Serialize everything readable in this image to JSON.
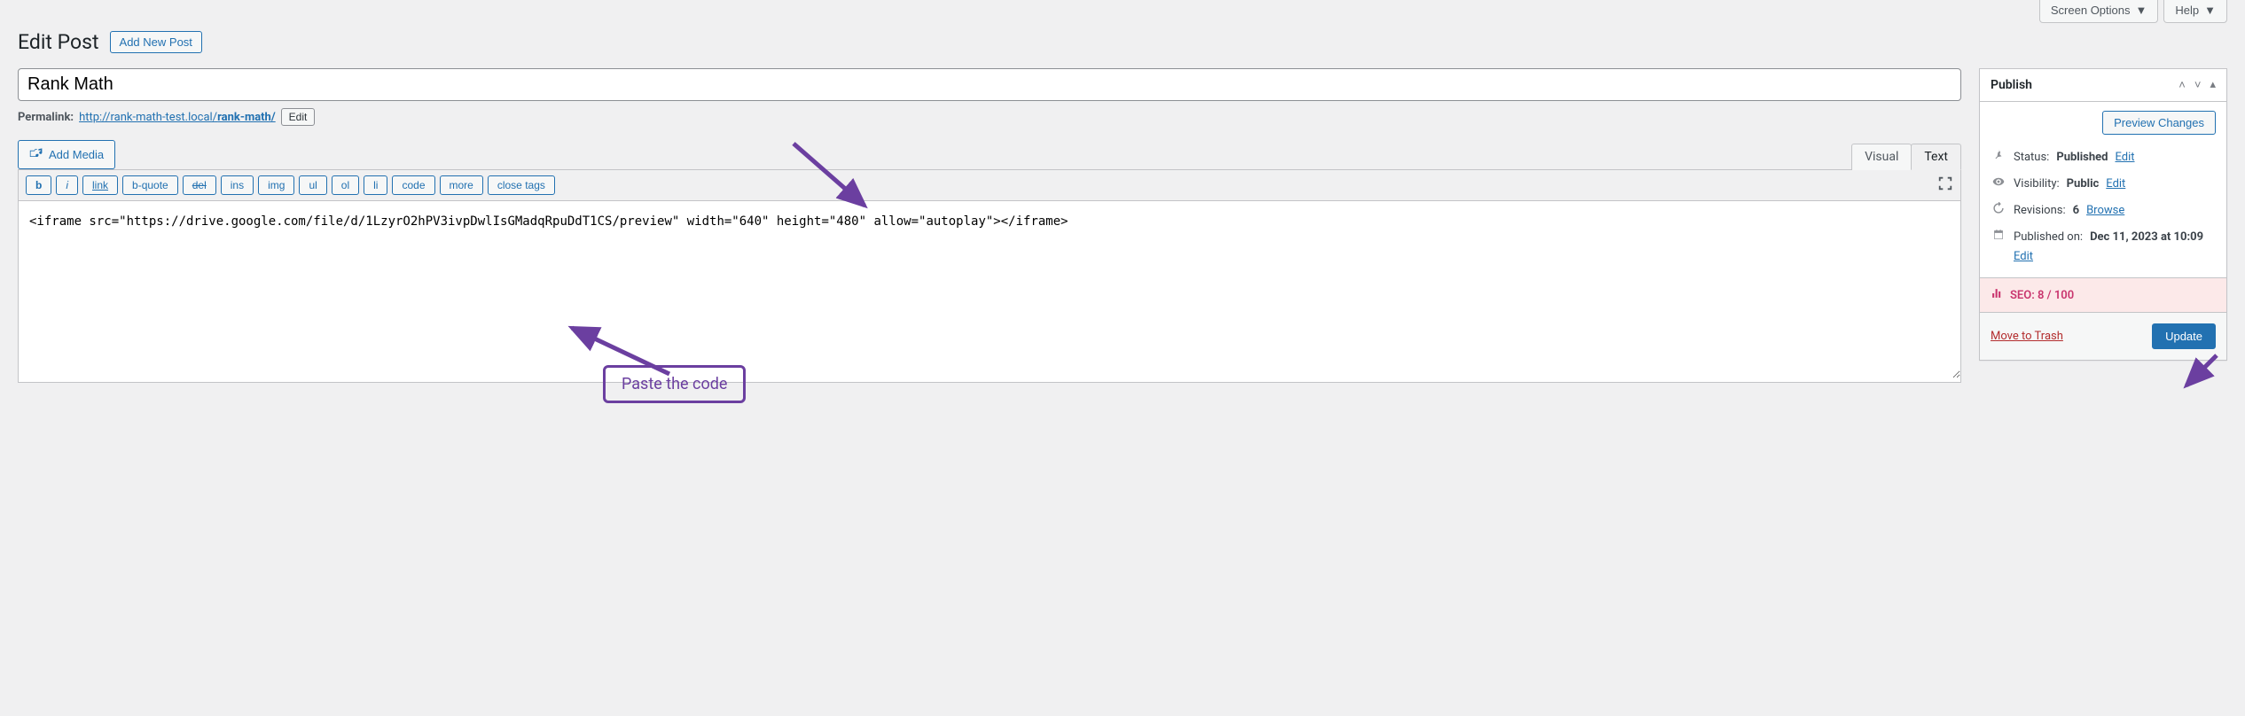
{
  "topbar": {
    "screen_options": "Screen Options",
    "help": "Help"
  },
  "header": {
    "title": "Edit Post",
    "add_new": "Add New Post"
  },
  "post": {
    "title": "Rank Math",
    "permalink_label": "Permalink:",
    "permalink_base": "http://rank-math-test.local/",
    "permalink_slug": "rank-math/",
    "edit_slug": "Edit"
  },
  "media": {
    "add_media": "Add Media"
  },
  "tabs": {
    "visual": "Visual",
    "text": "Text"
  },
  "quicktags": {
    "b": "b",
    "i": "i",
    "link": "link",
    "bquote": "b-quote",
    "del": "del",
    "ins": "ins",
    "img": "img",
    "ul": "ul",
    "ol": "ol",
    "li": "li",
    "code": "code",
    "more": "more",
    "close": "close tags"
  },
  "editor": {
    "content": "<iframe src=\"https://drive.google.com/file/d/1LzyrO2hPV3ivpDwlIsGMadqRpuDdT1CS/preview\" width=\"640\" height=\"480\" allow=\"autoplay\"></iframe>"
  },
  "publish": {
    "box_title": "Publish",
    "preview": "Preview Changes",
    "status_label": "Status:",
    "status_value": "Published",
    "visibility_label": "Visibility:",
    "visibility_value": "Public",
    "revisions_label": "Revisions:",
    "revisions_value": "6",
    "browse": "Browse",
    "published_label": "Published on:",
    "published_value": "Dec 11, 2023 at 10:09",
    "edit": "Edit",
    "seo_label": "SEO: 8 / 100",
    "trash": "Move to Trash",
    "update": "Update"
  },
  "annotations": {
    "paste_code": "Paste the code"
  }
}
